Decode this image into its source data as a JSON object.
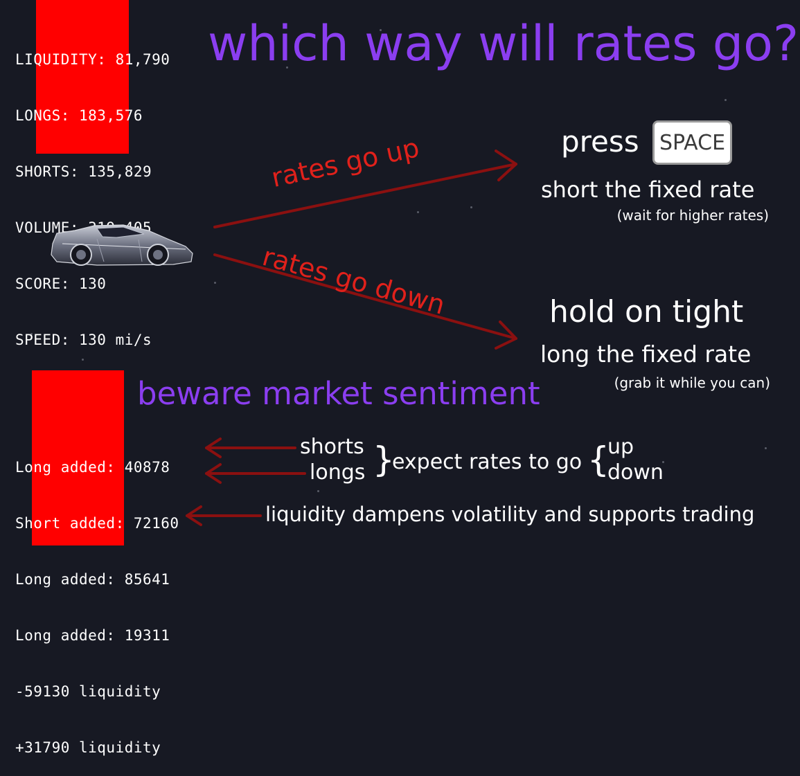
{
  "hud": {
    "liquidity": "LIQUIDITY: 81,790",
    "longs": "LONGS: 183,576",
    "shorts": "SHORTS: 135,829",
    "volume": "VOLUME: 319,405",
    "score": "SCORE: 130",
    "speed": "SPEED: 130 mi/s"
  },
  "title": "which way will rates go?",
  "arrows": {
    "up_label": "rates go up",
    "down_label": "rates go down"
  },
  "up_action": {
    "press": "press",
    "key": "SPACE",
    "action": "short the fixed rate",
    "note": "(wait for higher rates)"
  },
  "down_action": {
    "title": "hold on tight",
    "action": "long the fixed rate",
    "note": "(grab it while you can)"
  },
  "sentiment": {
    "heading": "beware market sentiment"
  },
  "log": {
    "lines": [
      "Long added: 40878",
      "Short added: 72160",
      "Long added: 85641",
      "Long added: 19311",
      "-59130 liquidity",
      "+31790 liquidity"
    ]
  },
  "legend": {
    "shorts": "shorts",
    "longs": "longs",
    "expect": "expect rates to go",
    "up": "up",
    "down": "down",
    "liquidity_note": "liquidity dampens volatility and supports trading"
  },
  "colors": {
    "background": "#171923",
    "purple": "#8b3ef0",
    "red_bar": "#ff0000",
    "arrow_dark_red": "#8b1010",
    "arrow_label_red": "#e0211b"
  },
  "icons": {
    "car": "car-sprite",
    "key": "space-key-icon"
  }
}
